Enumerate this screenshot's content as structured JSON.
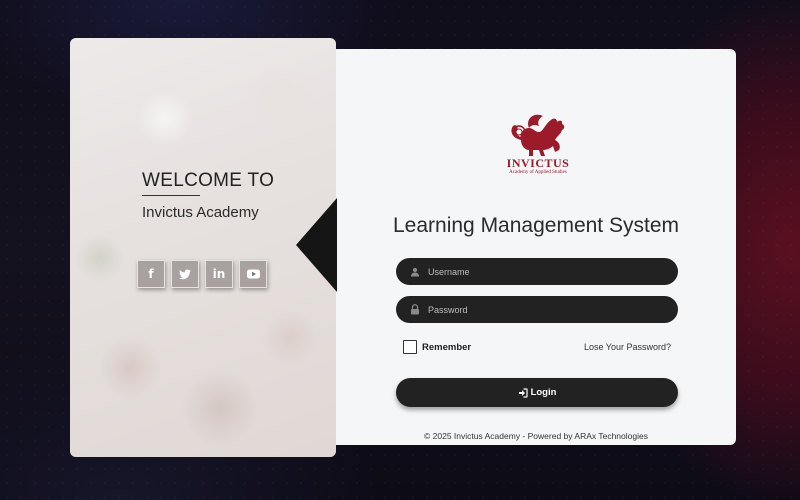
{
  "welcome": {
    "title": "WELCOME TO",
    "subtitle": "Invictus Academy"
  },
  "social": [
    {
      "icon": "facebook-icon",
      "glyph": "f"
    },
    {
      "icon": "twitter-icon",
      "glyph": "🐦"
    },
    {
      "icon": "linkedin-icon",
      "glyph": "in"
    },
    {
      "icon": "youtube-icon",
      "glyph": "▶"
    }
  ],
  "brand": {
    "name": "INVICTUS",
    "tagline": "Academy of Applied Studies",
    "color": "#9b1b2a"
  },
  "form": {
    "heading": "Learning Management System",
    "username_placeholder": "Username",
    "password_placeholder": "Password",
    "remember_label": "Remember",
    "lost_password_label": "Lose Your Password?",
    "login_label": "Login"
  },
  "footer": {
    "text": "© 2025 Invictus Academy - Powered by ARAx Technologies"
  },
  "colors": {
    "dark": "#222222",
    "card": "#f4f6f8"
  }
}
